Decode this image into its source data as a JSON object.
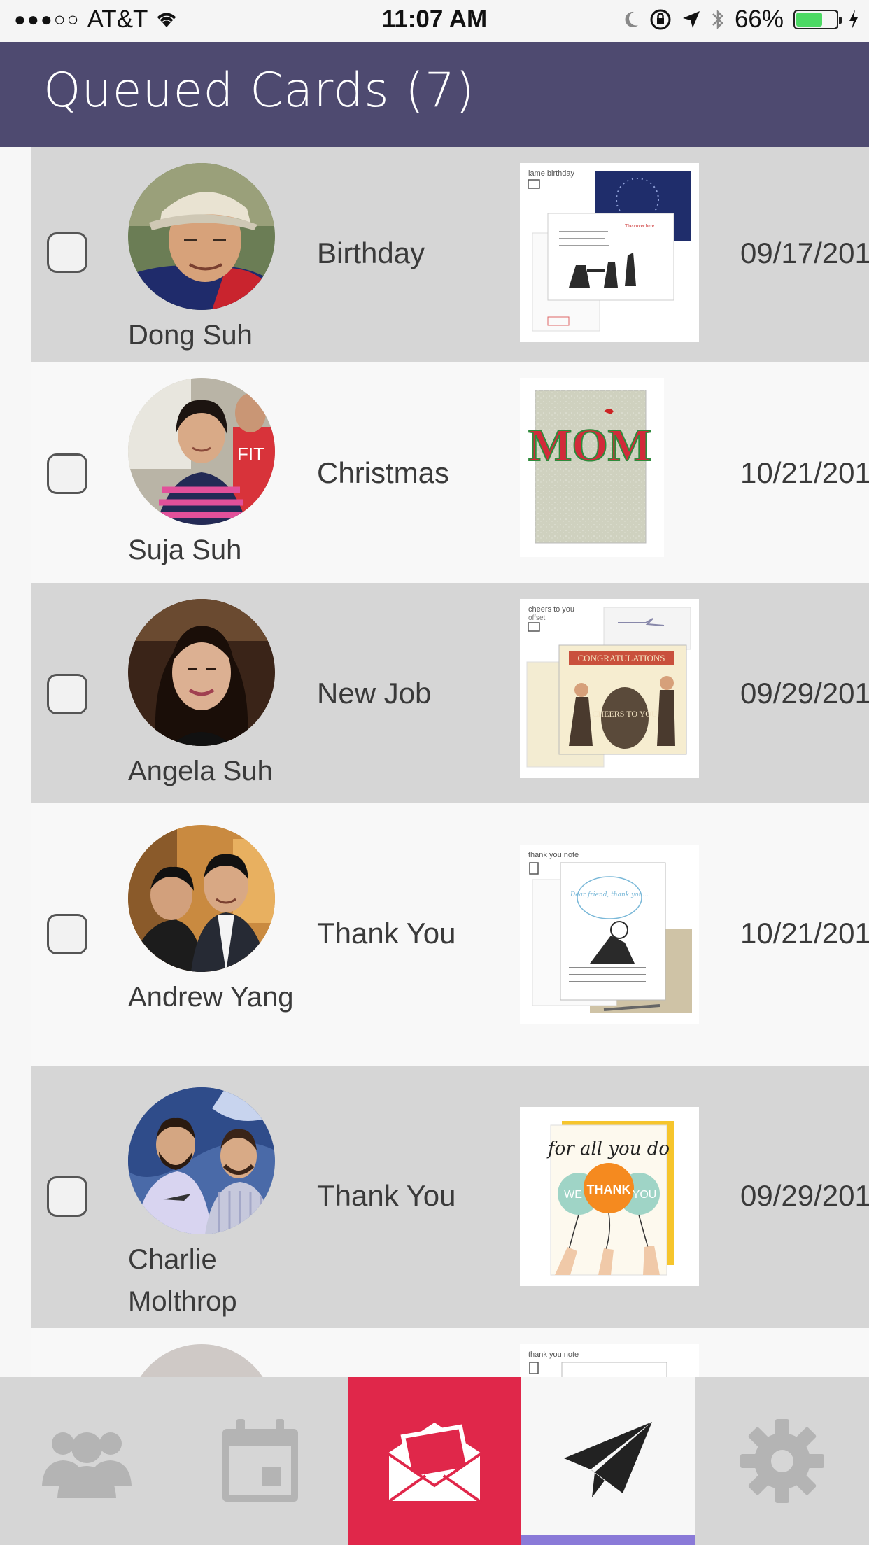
{
  "status_bar": {
    "signal": "●●●○○",
    "carrier": "AT&T",
    "time": "11:07 AM",
    "battery": "66%",
    "battery_level": 0.66
  },
  "header": {
    "title": "Queued Cards (7)"
  },
  "rows": [
    {
      "name": "Dong Suh",
      "occasion": "Birthday",
      "date": "09/17/201"
    },
    {
      "name": "Suja Suh",
      "occasion": "Christmas",
      "date": "10/21/201"
    },
    {
      "name": "Angela Suh",
      "occasion": "New Job",
      "date": "09/29/201"
    },
    {
      "name": "Andrew Yang",
      "occasion": "Thank You",
      "date": "10/21/201"
    },
    {
      "name": "Charlie Molthrop",
      "occasion": "Thank You",
      "date": "09/29/201"
    }
  ],
  "cards": {
    "birthday_label": "lame birthday",
    "birthday_note": "The cover here",
    "mom_text": "MOM",
    "cheers_label": "cheers to you",
    "cheers_sub": "offset",
    "cheers_banner": "CONGRATULATIONS",
    "cheers_barrel": "CHEERS TO YOU",
    "thanks_label": "thank you note",
    "thanks_bubble": "Dear friend, thank you...",
    "foryou_text": "for all you do",
    "foryou_we": "WE",
    "foryou_thank": "THANK",
    "foryou_you": "YOU",
    "partial_label": "thank you note"
  },
  "tabs": [
    {
      "name": "people",
      "icon": "people-icon"
    },
    {
      "name": "calendar",
      "icon": "calendar-icon"
    },
    {
      "name": "cards",
      "icon": "envelope-icon"
    },
    {
      "name": "queued",
      "icon": "paper-plane-icon"
    },
    {
      "name": "settings",
      "icon": "gear-icon"
    }
  ],
  "colors": {
    "header": "#4e4a70",
    "row_shaded": "#d6d6d6",
    "accent_red": "#e0274a",
    "indicator": "#8a7ad8"
  }
}
